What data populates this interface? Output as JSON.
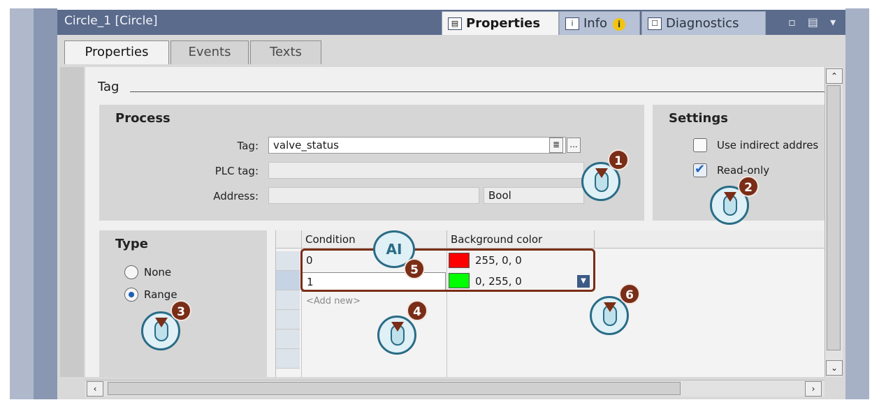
{
  "window": {
    "title": "Circle_1 [Circle]",
    "top_tabs": [
      {
        "label": "Properties",
        "icon": "properties-icon"
      },
      {
        "label": "Info",
        "icon": "info-icon",
        "badge": "i"
      },
      {
        "label": "Diagnostics",
        "icon": "diagnostics-icon"
      }
    ],
    "window_controls": "▫ ▤ ▾"
  },
  "sub_tabs": [
    "Properties",
    "Events",
    "Texts"
  ],
  "section": {
    "title": "Tag"
  },
  "process": {
    "title": "Process",
    "tag_label": "Tag:",
    "tag_value": "valve_status",
    "plc_tag_label": "PLC tag:",
    "plc_tag_value": "",
    "address_label": "Address:",
    "address_value": "",
    "type_value": "Bool",
    "browse_button": "..."
  },
  "settings": {
    "title": "Settings",
    "use_indirect_label": "Use indirect addres",
    "use_indirect_checked": false,
    "read_only_label": "Read-only",
    "read_only_checked": true
  },
  "type": {
    "title": "Type",
    "options": [
      {
        "label": "None",
        "checked": false
      },
      {
        "label": "Range",
        "checked": true
      }
    ]
  },
  "table": {
    "columns": [
      "Condition",
      "Background color"
    ],
    "rows": [
      {
        "condition": "0",
        "color_text": "255, 0, 0",
        "color": "#ff0000"
      },
      {
        "condition": "1",
        "color_text": "0, 255, 0",
        "color": "#00ff00"
      }
    ],
    "add_new": "<Add new>"
  },
  "callouts": [
    "1",
    "2",
    "3",
    "4",
    "5",
    "6"
  ],
  "ai_label": "AI",
  "colors": {
    "accent": "#7a2d17",
    "title_bar": "#5b6b8c",
    "cursor": "#2a6c86"
  }
}
